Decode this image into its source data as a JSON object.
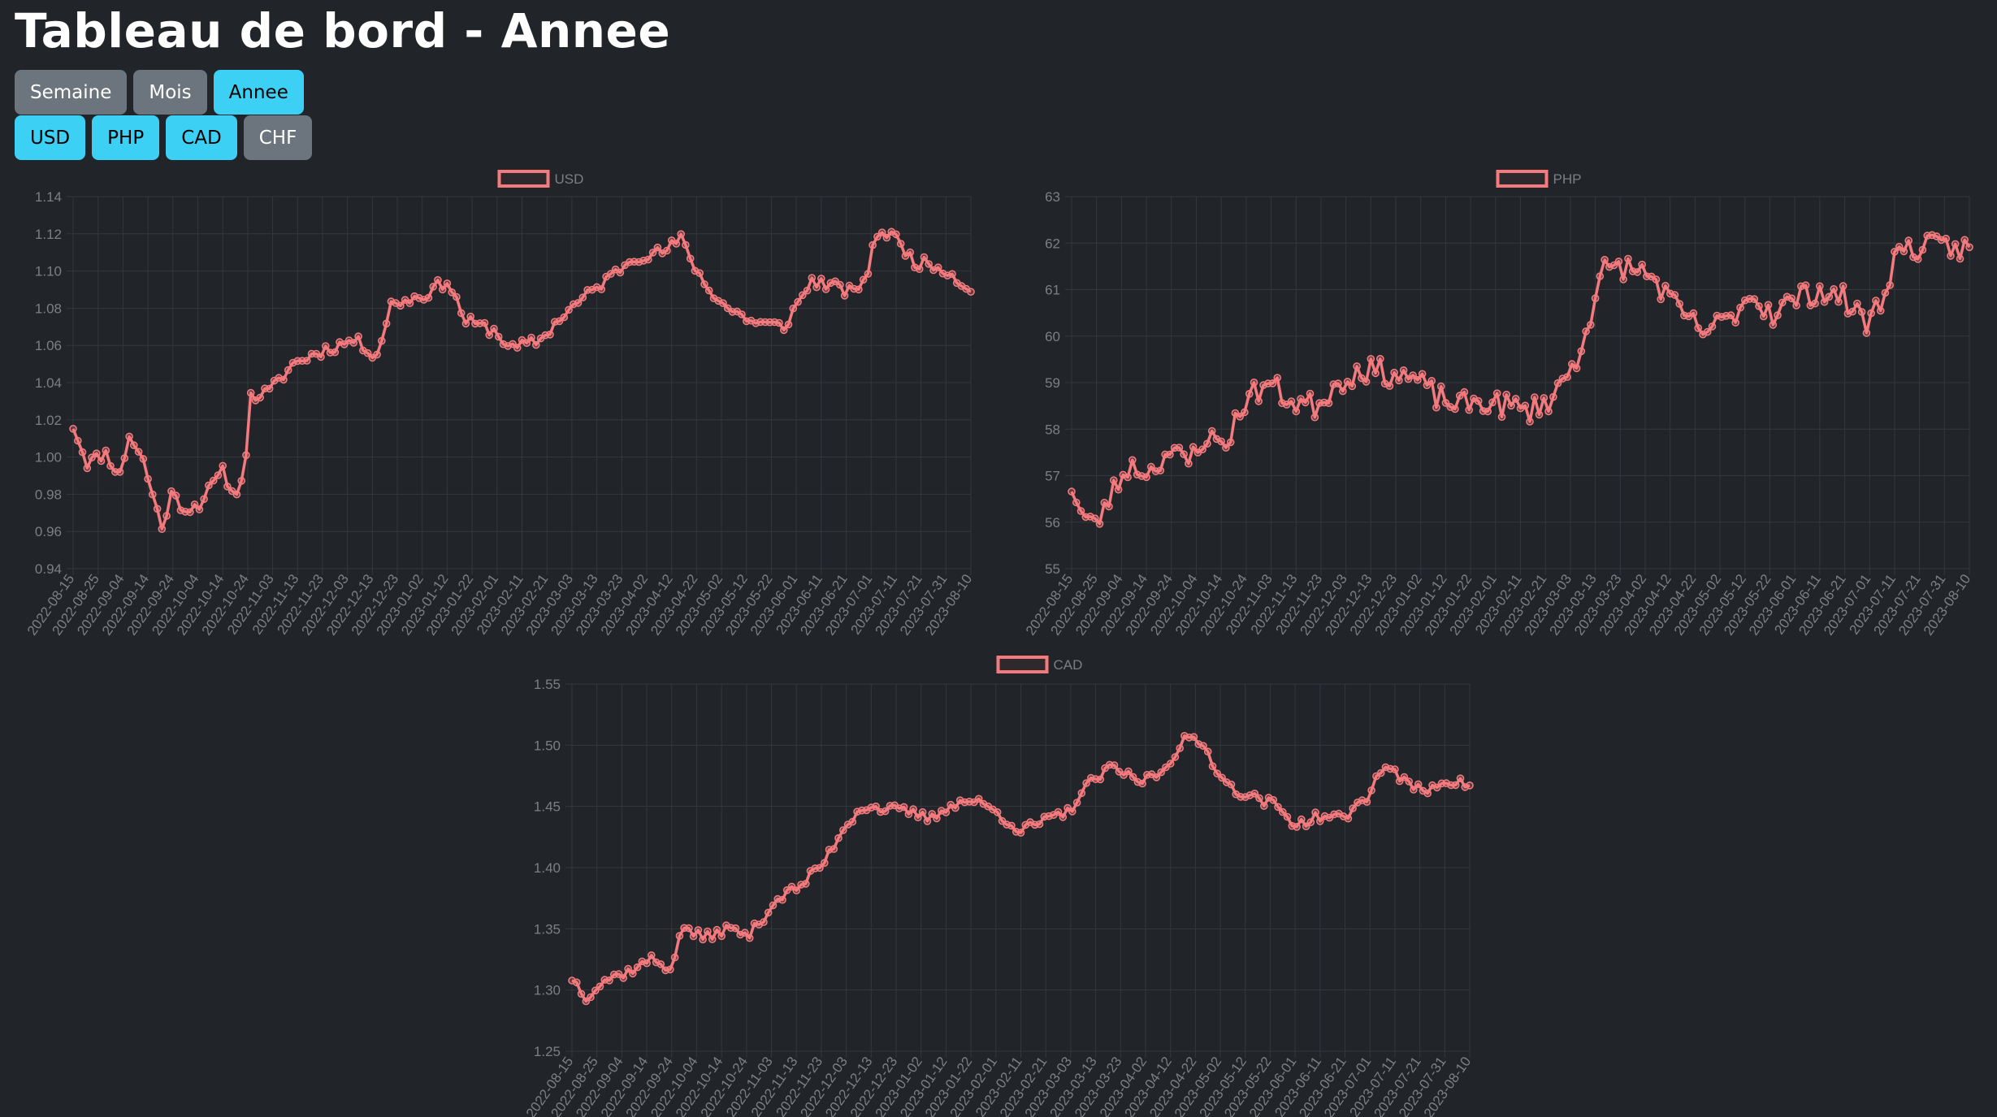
{
  "page": {
    "title": "Tableau de bord - Annee"
  },
  "period_buttons": [
    {
      "label": "Semaine",
      "active": false
    },
    {
      "label": "Mois",
      "active": false
    },
    {
      "label": "Annee",
      "active": true
    }
  ],
  "currency_buttons": [
    {
      "label": "USD",
      "active": true
    },
    {
      "label": "PHP",
      "active": true
    },
    {
      "label": "CAD",
      "active": true
    },
    {
      "label": "CHF",
      "active": false
    }
  ],
  "colors": {
    "background": "#212529",
    "line": "#f47a7e",
    "grid": "#34373c",
    "tick_text": "#7c7f84",
    "button_active": "#3dd0f5",
    "button_inactive": "#6c757d"
  },
  "chart_data": [
    {
      "type": "line",
      "series": [
        {
          "name": "USD"
        }
      ],
      "x_labels": [
        "2022-08-15",
        "2022-08-25",
        "2022-09-04",
        "2022-09-14",
        "2022-09-24",
        "2022-10-04",
        "2022-10-14",
        "2022-10-24",
        "2022-11-03",
        "2022-11-13",
        "2022-11-23",
        "2022-12-03",
        "2022-12-13",
        "2022-12-23",
        "2023-01-02",
        "2023-01-12",
        "2023-01-22",
        "2023-02-01",
        "2023-02-11",
        "2023-02-21",
        "2023-03-03",
        "2023-03-13",
        "2023-03-23",
        "2023-04-02",
        "2023-04-12",
        "2023-04-22",
        "2023-05-02",
        "2023-05-12",
        "2023-05-22",
        "2023-06-01",
        "2023-06-11",
        "2023-06-21",
        "2023-07-01",
        "2023-07-11",
        "2023-07-21",
        "2023-07-31",
        "2023-08-10"
      ],
      "ylim": [
        0.94,
        1.14
      ],
      "y_ticks": [
        "1.14",
        "1.12",
        "1.10",
        "1.08",
        "1.06",
        "1.04",
        "1.02",
        "1.00",
        "0.98",
        "0.96",
        "0.94"
      ],
      "anchors": [
        [
          0,
          1.017
        ],
        [
          3,
          0.997
        ],
        [
          7,
          1.002
        ],
        [
          10,
          0.99
        ],
        [
          12,
          1.012
        ],
        [
          15,
          0.998
        ],
        [
          19,
          0.962
        ],
        [
          21,
          0.98
        ],
        [
          24,
          0.972
        ],
        [
          27,
          0.975
        ],
        [
          32,
          0.992
        ],
        [
          35,
          0.978
        ],
        [
          37,
          1.003
        ],
        [
          38,
          1.032
        ],
        [
          42,
          1.035
        ],
        [
          47,
          1.05
        ],
        [
          53,
          1.057
        ],
        [
          60,
          1.063
        ],
        [
          65,
          1.055
        ],
        [
          68,
          1.082
        ],
        [
          75,
          1.087
        ],
        [
          80,
          1.095
        ],
        [
          84,
          1.073
        ],
        [
          90,
          1.068
        ],
        [
          94,
          1.058
        ],
        [
          100,
          1.063
        ],
        [
          105,
          1.077
        ],
        [
          110,
          1.087
        ],
        [
          115,
          1.097
        ],
        [
          120,
          1.108
        ],
        [
          126,
          1.11
        ],
        [
          130,
          1.117
        ],
        [
          135,
          1.093
        ],
        [
          140,
          1.08
        ],
        [
          146,
          1.072
        ],
        [
          152,
          1.07
        ],
        [
          158,
          1.095
        ],
        [
          162,
          1.092
        ],
        [
          167,
          1.088
        ],
        [
          170,
          1.1
        ],
        [
          172,
          1.121
        ],
        [
          175,
          1.12
        ],
        [
          180,
          1.105
        ],
        [
          186,
          1.102
        ],
        [
          192,
          1.09
        ]
      ],
      "noise": 0.0035,
      "seed": 11
    },
    {
      "type": "line",
      "series": [
        {
          "name": "PHP"
        }
      ],
      "x_labels": [
        "2022-08-15",
        "2022-08-25",
        "2022-09-04",
        "2022-09-14",
        "2022-09-24",
        "2022-10-04",
        "2022-10-14",
        "2022-10-24",
        "2022-11-03",
        "2022-11-13",
        "2022-11-23",
        "2022-12-03",
        "2022-12-13",
        "2022-12-23",
        "2023-01-02",
        "2023-01-12",
        "2023-01-22",
        "2023-02-01",
        "2023-02-11",
        "2023-02-21",
        "2023-03-03",
        "2023-03-13",
        "2023-03-23",
        "2023-04-02",
        "2023-04-12",
        "2023-04-22",
        "2023-05-02",
        "2023-05-12",
        "2023-05-22",
        "2023-06-01",
        "2023-06-11",
        "2023-06-21",
        "2023-07-01",
        "2023-07-11",
        "2023-07-21",
        "2023-07-31",
        "2023-08-10"
      ],
      "ylim": [
        55,
        63
      ],
      "y_ticks": [
        "63",
        "62",
        "61",
        "60",
        "59",
        "58",
        "57",
        "56",
        "55"
      ],
      "anchors": [
        [
          0,
          56.8
        ],
        [
          2,
          56.2
        ],
        [
          5,
          55.9
        ],
        [
          8,
          56.5
        ],
        [
          12,
          57.2
        ],
        [
          17,
          57.1
        ],
        [
          20,
          57.5
        ],
        [
          25,
          57.3
        ],
        [
          28,
          57.8
        ],
        [
          33,
          57.7
        ],
        [
          37,
          58.6
        ],
        [
          42,
          59.0
        ],
        [
          47,
          58.6
        ],
        [
          52,
          58.5
        ],
        [
          57,
          59.0
        ],
        [
          62,
          59.3
        ],
        [
          68,
          59.2
        ],
        [
          73,
          59.1
        ],
        [
          78,
          58.7
        ],
        [
          83,
          58.5
        ],
        [
          88,
          58.6
        ],
        [
          93,
          58.5
        ],
        [
          98,
          58.4
        ],
        [
          103,
          58.7
        ],
        [
          108,
          59.5
        ],
        [
          111,
          60.5
        ],
        [
          114,
          61.4
        ],
        [
          118,
          61.5
        ],
        [
          124,
          61.3
        ],
        [
          130,
          60.5
        ],
        [
          135,
          60.1
        ],
        [
          140,
          60.3
        ],
        [
          145,
          60.9
        ],
        [
          150,
          60.5
        ],
        [
          155,
          60.8
        ],
        [
          160,
          61.0
        ],
        [
          165,
          60.8
        ],
        [
          170,
          60.3
        ],
        [
          173,
          60.7
        ],
        [
          176,
          61.7
        ],
        [
          179,
          61.9
        ]
      ],
      "noise": 0.28,
      "seed": 23
    },
    {
      "type": "line",
      "series": [
        {
          "name": "CAD"
        }
      ],
      "x_labels": [
        "2022-08-15",
        "2022-08-25",
        "2022-09-04",
        "2022-09-14",
        "2022-09-24",
        "2022-10-04",
        "2022-10-14",
        "2022-10-24",
        "2022-11-03",
        "2022-11-13",
        "2022-11-23",
        "2022-12-03",
        "2022-12-13",
        "2022-12-23",
        "2023-01-02",
        "2023-01-12",
        "2023-01-22",
        "2023-02-01",
        "2023-02-11",
        "2023-02-21",
        "2023-03-03",
        "2023-03-13",
        "2023-03-23",
        "2023-04-02",
        "2023-04-12",
        "2023-04-22",
        "2023-05-02",
        "2023-05-12",
        "2023-05-22",
        "2023-06-01",
        "2023-06-11",
        "2023-06-21",
        "2023-07-01",
        "2023-07-11",
        "2023-07-21",
        "2023-07-31",
        "2023-08-10"
      ],
      "ylim": [
        1.25,
        1.55
      ],
      "y_ticks": [
        "1.55",
        "1.50",
        "1.45",
        "1.40",
        "1.35",
        "1.30",
        "1.25"
      ],
      "anchors": [
        [
          0,
          1.31
        ],
        [
          3,
          1.295
        ],
        [
          7,
          1.308
        ],
        [
          12,
          1.315
        ],
        [
          17,
          1.325
        ],
        [
          21,
          1.318
        ],
        [
          24,
          1.352
        ],
        [
          28,
          1.342
        ],
        [
          33,
          1.35
        ],
        [
          38,
          1.345
        ],
        [
          44,
          1.375
        ],
        [
          49,
          1.385
        ],
        [
          54,
          1.405
        ],
        [
          58,
          1.432
        ],
        [
          62,
          1.45
        ],
        [
          67,
          1.448
        ],
        [
          72,
          1.445
        ],
        [
          77,
          1.44
        ],
        [
          81,
          1.452
        ],
        [
          86,
          1.455
        ],
        [
          91,
          1.445
        ],
        [
          96,
          1.43
        ],
        [
          101,
          1.438
        ],
        [
          106,
          1.445
        ],
        [
          111,
          1.47
        ],
        [
          116,
          1.482
        ],
        [
          121,
          1.47
        ],
        [
          126,
          1.478
        ],
        [
          131,
          1.505
        ],
        [
          135,
          1.5
        ],
        [
          140,
          1.468
        ],
        [
          145,
          1.458
        ],
        [
          150,
          1.452
        ],
        [
          155,
          1.435
        ],
        [
          160,
          1.442
        ],
        [
          165,
          1.44
        ],
        [
          170,
          1.458
        ],
        [
          174,
          1.485
        ],
        [
          178,
          1.47
        ],
        [
          182,
          1.462
        ],
        [
          187,
          1.472
        ],
        [
          191,
          1.468
        ]
      ],
      "noise": 0.0045,
      "seed": 37
    }
  ]
}
